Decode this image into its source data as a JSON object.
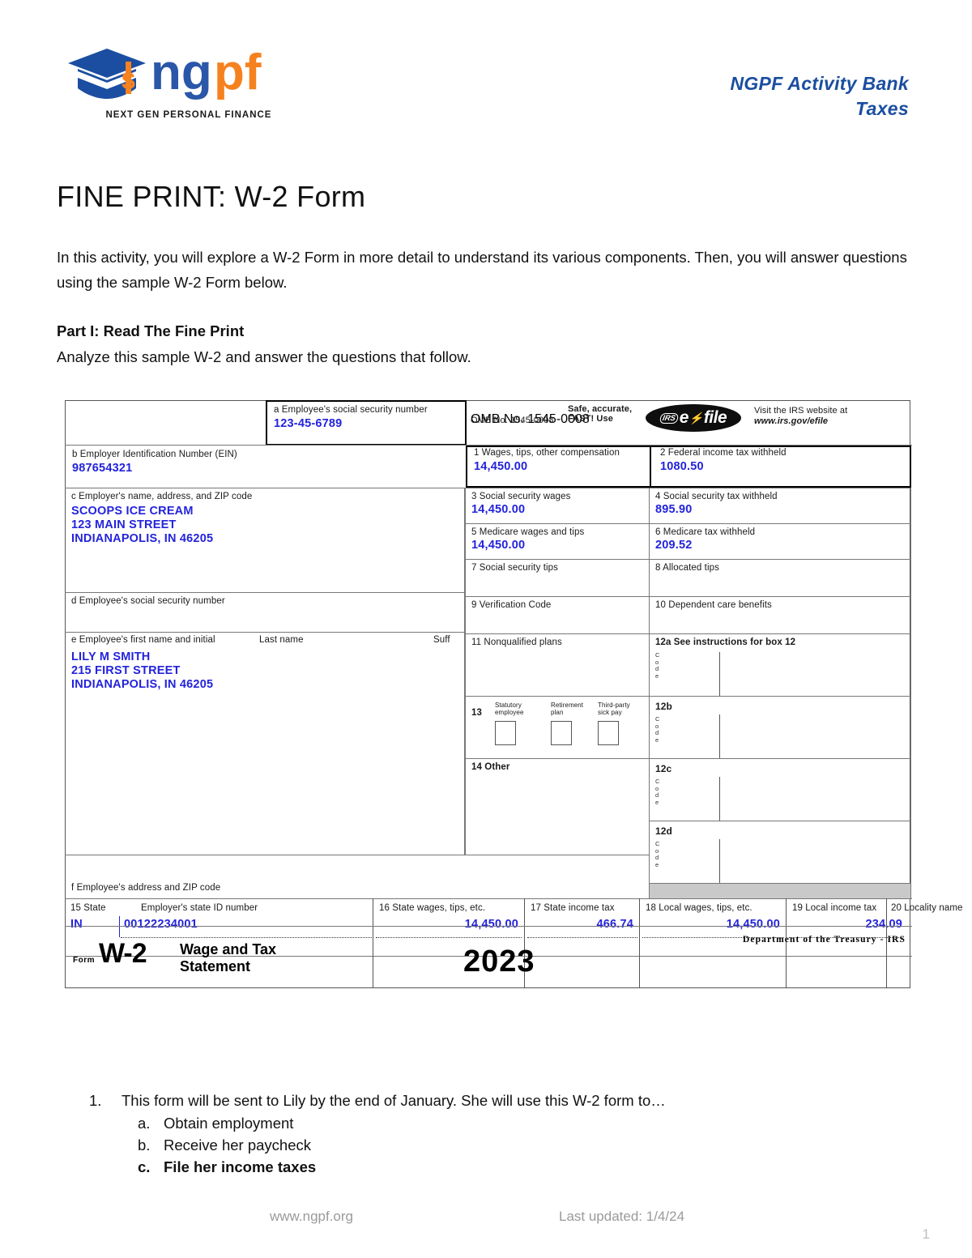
{
  "brand": {
    "logo_text": "ngpf",
    "logo_tagline": "NEXT GEN PERSONAL FINANCE",
    "logo_blue": "#1b4ea0",
    "logo_orange": "#f5821f"
  },
  "header": {
    "activity_bank": "NGPF Activity Bank",
    "category": "Taxes"
  },
  "title": "FINE PRINT: W-2 Form",
  "intro": "In this activity, you will explore a W-2 Form in more detail to understand its various components. Then, you will answer questions using the sample W-2 Form below.",
  "part": {
    "heading": "Part I: Read The Fine Print",
    "subheading": "Analyze this sample W-2 and answer the questions that follow."
  },
  "w2": {
    "box_a_label": "a  Employee's social security number",
    "box_a_value": "123-45-6789",
    "omb": "OMB No. 1545-0008",
    "safe_line1": "Safe, accurate,",
    "safe_line2": "FAST! Use",
    "efile_irs": "IRS",
    "efile_e": "e",
    "efile_file": "file",
    "visit_line1": "Visit the IRS website at",
    "visit_line2": "www.irs.gov/efile",
    "box_b_label": "b  Employer Identification Number (EIN)",
    "box_b_value": "987654321",
    "box_1_label": "1  Wages, tips, other compensation",
    "box_1_value": "14,450.00",
    "box_2_label": "2  Federal income tax withheld",
    "box_2_value": "1080.50",
    "box_c_label": "c  Employer's name, address, and ZIP code",
    "employer_name": "SCOOPS ICE CREAM",
    "employer_street": "123 MAIN STREET",
    "employer_citystate": "INDIANAPOLIS, IN 46205",
    "box_3_label": "3  Social security wages",
    "box_3_value": "14,450.00",
    "box_4_label": "4  Social security tax withheld",
    "box_4_value": "895.90",
    "box_5_label": "5  Medicare wages and tips",
    "box_5_value": "14,450.00",
    "box_6_label": "6  Medicare tax withheld",
    "box_6_value": "209.52",
    "box_7_label": "7  Social security tips",
    "box_7_value": "",
    "box_8_label": "8  Allocated tips",
    "box_8_value": "",
    "box_d_label": "d  Employee's social security number",
    "box_d_value": "",
    "box_9_label": "9  Verification Code",
    "box_9_value": "",
    "box_10_label": "10 Dependent care benefits",
    "box_10_value": "",
    "box_e_label_1": "e  Employee's first name and initial",
    "box_e_label_2": "Last name",
    "box_e_label_3": "Suff",
    "employee_name": "LILY M SMITH",
    "employee_street": "215 FIRST STREET",
    "employee_citystate": "INDIANAPOLIS, IN 46205",
    "box_11_label": "11 Nonqualified plans",
    "box_11_value": "",
    "box_12a_label": "12a See instructions for box 12",
    "box_12a_value": "",
    "box_12b_label": "12b",
    "box_12b_value": "",
    "box_12c_label": "12c",
    "box_12c_value": "",
    "box_12d_label": "12d",
    "box_12d_value": "",
    "code_word": "Code",
    "box_13_num": "13",
    "box_13_statutory_1": "Statutory",
    "box_13_statutory_2": "employee",
    "box_13_retirement_1": "Retirement",
    "box_13_retirement_2": "plan",
    "box_13_thirdparty_1": "Third-party",
    "box_13_thirdparty_2": "sick pay",
    "box_14_label": "14 Other",
    "box_14_value": "",
    "box_f_label": "f  Employee's address and ZIP code",
    "box_15_label_state": "15 State",
    "box_15_label_id": "Employer's state ID number",
    "box_15_state": "IN",
    "box_15_id": "00122234001",
    "box_16_label": "16 State wages, tips, etc.",
    "box_16_value": "14,450.00",
    "box_17_label": "17 State income tax",
    "box_17_value": "466.74",
    "box_18_label": "18 Local wages, tips, etc.",
    "box_18_value": "14,450.00",
    "box_19_label": "19 Local income tax",
    "box_19_value": "234.09",
    "box_20_label": "20 Locality name",
    "box_20_value": "",
    "form_word": "Form",
    "form_number": "W-2",
    "form_title_1": "Wage and Tax",
    "form_title_2": "Statement",
    "tax_year": "2023",
    "treasury": "Department of the Treasury - IRS"
  },
  "questions": [
    {
      "number": "1.",
      "text": "This form will be sent to Lily by the end of January. She will use this W-2 form to…",
      "answers": [
        {
          "letter": "a.",
          "text": "Obtain employment",
          "correct": false
        },
        {
          "letter": "b.",
          "text": "Receive her paycheck",
          "correct": false
        },
        {
          "letter": "c.",
          "text": "File her income taxes",
          "correct": true
        }
      ]
    }
  ],
  "footer": {
    "website": "www.ngpf.org",
    "last_updated": "Last updated: 1/4/24",
    "page_number": "1"
  }
}
